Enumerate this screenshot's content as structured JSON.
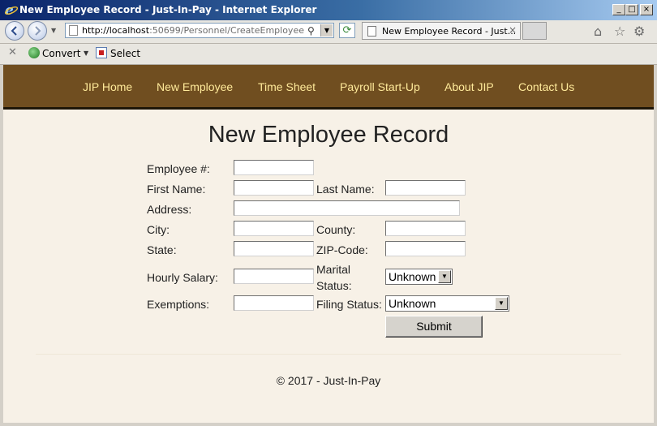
{
  "window": {
    "title": "New Employee Record - Just-In-Pay - Internet Explorer",
    "minimize_glyph": "_",
    "maximize_glyph": "□",
    "close_glyph": "×"
  },
  "browser": {
    "url_host": "http://localhost",
    "url_rest": ":50699/Personnel/CreateEmployee",
    "tab_title": "New Employee Record - Just...",
    "tab_close": "×",
    "toolbar": {
      "convert_label": "Convert",
      "select_label": "Select"
    },
    "icons": [
      "back-icon",
      "forward-icon",
      "search-icon",
      "refresh-icon",
      "home-icon",
      "star-icon",
      "gear-icon"
    ]
  },
  "site_nav": {
    "items": [
      "JIP Home",
      "New Employee",
      "Time Sheet",
      "Payroll Start-Up",
      "About JIP",
      "Contact Us"
    ]
  },
  "form": {
    "title": "New Employee Record",
    "labels": {
      "employee_number": "Employee #:",
      "first_name": "First Name:",
      "last_name": "Last Name:",
      "address": "Address:",
      "city": "City:",
      "county": "County:",
      "state": "State:",
      "zip": "ZIP-Code:",
      "hourly_salary": "Hourly Salary:",
      "marital_status_line1": "Marital",
      "marital_status_line2": "Status:",
      "exemptions": "Exemptions:",
      "filing_status": "Filing Status:"
    },
    "values": {
      "employee_number": "",
      "first_name": "",
      "last_name": "",
      "address": "",
      "city": "",
      "county": "",
      "state": "",
      "zip": "",
      "hourly_salary": "",
      "exemptions": ""
    },
    "marital_status_selected": "Unknown",
    "filing_status_selected": "Unknown",
    "submit_label": "Submit"
  },
  "footer": {
    "text": "© 2017 - Just-In-Pay"
  },
  "colors": {
    "nav_background": "#704e20",
    "nav_link": "#ffea9a",
    "page_background": "#f7f1e7"
  }
}
